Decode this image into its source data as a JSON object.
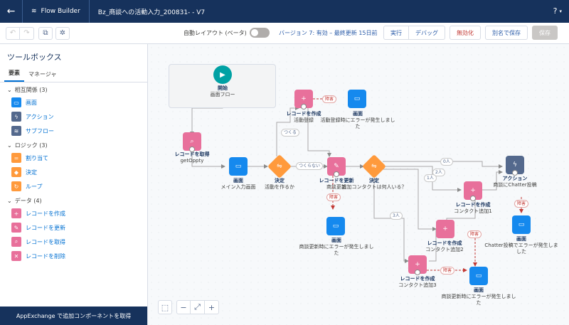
{
  "header": {
    "back_icon": "back-arrow-icon",
    "app_name": "Flow Builder",
    "flow_title": "Bz_商談への活動入力_200831- - V7",
    "help_label": "?"
  },
  "toolbar": {
    "auto_layout_label": "自動レイアウト (ベータ)",
    "version_text": "バージョン 7: 有効 – 最終更新 15日前",
    "run": "実行",
    "debug": "デバッグ",
    "deactivate": "無効化",
    "save_as": "別名で保存",
    "save": "保存"
  },
  "sidebar": {
    "title": "ツールボックス",
    "tabs": [
      "要素",
      "マネージャ"
    ],
    "sections": [
      {
        "label": "相互関係 (3)",
        "items": [
          {
            "label": "画面",
            "color": "#1589ee",
            "icon": "screen-icon"
          },
          {
            "label": "アクション",
            "color": "#54698d",
            "icon": "lightning-icon"
          },
          {
            "label": "サブフロー",
            "color": "#54698d",
            "icon": "subflow-icon"
          }
        ]
      },
      {
        "label": "ロジック (3)",
        "items": [
          {
            "label": "割り当て",
            "color": "#ff9a3c",
            "icon": "assignment-icon"
          },
          {
            "label": "決定",
            "color": "#ff9a3c",
            "icon": "decision-icon"
          },
          {
            "label": "ループ",
            "color": "#ff9a3c",
            "icon": "loop-icon"
          }
        ]
      },
      {
        "label": "データ (4)",
        "items": [
          {
            "label": "レコードを作成",
            "color": "#e8709b",
            "icon": "record-create-icon"
          },
          {
            "label": "レコードを更新",
            "color": "#e8709b",
            "icon": "record-update-icon"
          },
          {
            "label": "レコードを取得",
            "color": "#e8709b",
            "icon": "record-lookup-icon"
          },
          {
            "label": "レコードを削除",
            "color": "#e8709b",
            "icon": "record-delete-icon"
          }
        ]
      }
    ],
    "footer": "AppExchange で追加コンポーネントを取得"
  },
  "canvas": {
    "start": {
      "title": "開始",
      "sub": "画面フロー"
    },
    "nodes": {
      "get_record": {
        "type": "レコードを取得",
        "name": "getOppty"
      },
      "screen_main": {
        "type": "画面",
        "name": "メイン入力画面"
      },
      "decision1": {
        "type": "決定",
        "name": "活動を作るか"
      },
      "create_activity": {
        "type": "レコードを作成",
        "name": "活動登録"
      },
      "screen_err1": {
        "type": "画面",
        "name": "活動登録時にエラーが発生しました"
      },
      "update_record": {
        "type": "レコードを更新",
        "name": "商談更新"
      },
      "screen_err2": {
        "type": "画面",
        "name": "商談更新時にエラーが発生しました"
      },
      "decision2": {
        "type": "決定",
        "name": "追加コンタクトは何人いる？"
      },
      "action_chatter": {
        "type": "アクション",
        "name": "商談にChatter投稿"
      },
      "screen_err3": {
        "type": "画面",
        "name": "Chatter投稿でエラーが発生しました"
      },
      "create_contact1": {
        "type": "レコードを作成",
        "name": "コンタクト追加1"
      },
      "create_contact2": {
        "type": "レコードを作成",
        "name": "コンタクト追加2"
      },
      "create_contact3": {
        "type": "レコードを作成",
        "name": "コンタクト追加3"
      },
      "screen_err4": {
        "type": "画面",
        "name": "商談更新時にエラーが発生しました"
      }
    },
    "edge_labels": {
      "make": "つくる",
      "not_make": "つくらない",
      "fault": "障害",
      "zero": "0人",
      "one": "1人",
      "two": "2人",
      "three": "3人"
    }
  },
  "colors": {
    "header_bg": "#16325c",
    "screen": "#1589ee",
    "record": "#e8709b",
    "decision": "#ff9a3c",
    "action": "#54698d",
    "start": "#00a1a4",
    "fault": "#c23934"
  }
}
